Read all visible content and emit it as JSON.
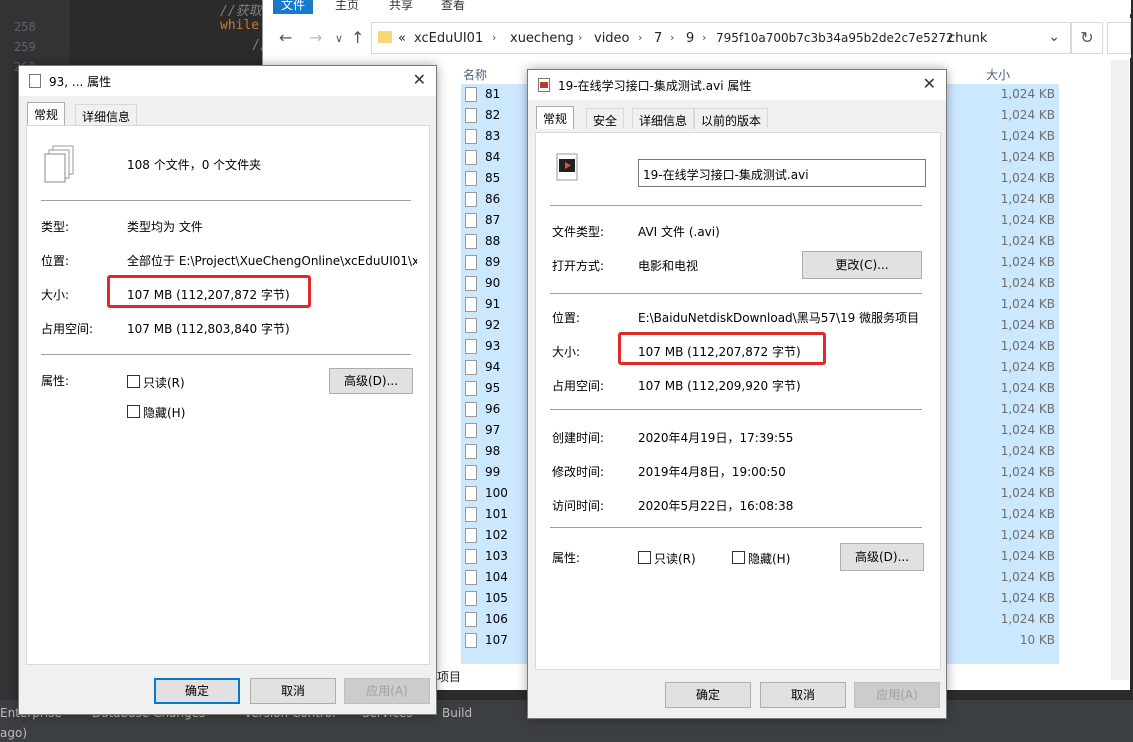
{
  "ide": {
    "line_numbers": [
      "258",
      "259",
      "260"
    ],
    "code_keyword": "while(",
    "code_comment_a": "//获取",
    "code_comment_b": "//",
    "bottom_items": [
      "Enterprise",
      "Database Changes",
      "Version Control",
      "Services",
      "Build"
    ],
    "bottom_left": "ago)"
  },
  "explorer": {
    "ribbon_tabs": [
      "文件",
      "主页",
      "共享",
      "查看"
    ],
    "breadcrumb_overflow": "«",
    "breadcrumbs": [
      "xcEduUI01",
      "xuecheng",
      "video",
      "7",
      "9",
      "795f10a700b7c3b34a95b2de2c7e5272",
      "chunk"
    ],
    "columns": {
      "name": "名称",
      "size": "大小"
    },
    "files": [
      {
        "name": "81",
        "size": "1,024 KB"
      },
      {
        "name": "82",
        "size": "1,024 KB"
      },
      {
        "name": "83",
        "size": "1,024 KB"
      },
      {
        "name": "84",
        "size": "1,024 KB"
      },
      {
        "name": "85",
        "size": "1,024 KB"
      },
      {
        "name": "86",
        "size": "1,024 KB"
      },
      {
        "name": "87",
        "size": "1,024 KB"
      },
      {
        "name": "88",
        "size": "1,024 KB"
      },
      {
        "name": "89",
        "size": "1,024 KB"
      },
      {
        "name": "90",
        "size": "1,024 KB"
      },
      {
        "name": "91",
        "size": "1,024 KB"
      },
      {
        "name": "92",
        "size": "1,024 KB"
      },
      {
        "name": "93",
        "size": "1,024 KB"
      },
      {
        "name": "94",
        "size": "1,024 KB"
      },
      {
        "name": "95",
        "size": "1,024 KB"
      },
      {
        "name": "96",
        "size": "1,024 KB"
      },
      {
        "name": "97",
        "size": "1,024 KB"
      },
      {
        "name": "98",
        "size": "1,024 KB"
      },
      {
        "name": "99",
        "size": "1,024 KB"
      },
      {
        "name": "100",
        "size": "1,024 KB"
      },
      {
        "name": "101",
        "size": "1,024 KB"
      },
      {
        "name": "102",
        "size": "1,024 KB"
      },
      {
        "name": "103",
        "size": "1,024 KB"
      },
      {
        "name": "104",
        "size": "1,024 KB"
      },
      {
        "name": "105",
        "size": "1,024 KB"
      },
      {
        "name": "106",
        "size": "1,024 KB"
      },
      {
        "name": "107",
        "size": "10 KB"
      }
    ],
    "status_text": "项目"
  },
  "dialog_a": {
    "title": "93, ... 属性",
    "tabs": [
      "常规",
      "详细信息"
    ],
    "summary": "108 个文件，0 个文件夹",
    "type_label": "类型:",
    "type_value": "类型均为 文件",
    "location_label": "位置:",
    "location_value": "全部位于 E:\\Project\\XueChengOnline\\xcEduUI01\\x",
    "size_label": "大小:",
    "size_value": "107 MB (112,207,872 字节)",
    "disk_label": "占用空间:",
    "disk_value": "107 MB (112,803,840 字节)",
    "attr_label": "属性:",
    "readonly": "只读(R)",
    "hidden": "隐藏(H)",
    "advanced": "高级(D)...",
    "ok": "确定",
    "cancel": "取消",
    "apply": "应用(A)"
  },
  "dialog_b": {
    "title": "19-在线学习接口-集成测试.avi 属性",
    "tabs": [
      "常规",
      "安全",
      "详细信息",
      "以前的版本"
    ],
    "filename": "19-在线学习接口-集成测试.avi",
    "filetype_label": "文件类型:",
    "filetype_value": "AVI 文件 (.avi)",
    "openwith_label": "打开方式:",
    "openwith_value": "电影和电视",
    "change": "更改(C)...",
    "location_label": "位置:",
    "location_value": "E:\\BaiduNetdiskDownload\\黑马57\\19 微服务项目【",
    "size_label": "大小:",
    "size_value": "107 MB (112,207,872 字节)",
    "disk_label": "占用空间:",
    "disk_value": "107 MB (112,209,920 字节)",
    "created_label": "创建时间:",
    "created_value": "2020年4月19日，17:39:55",
    "modified_label": "修改时间:",
    "modified_value": "2019年4月8日，19:00:50",
    "accessed_label": "访问时间:",
    "accessed_value": "2020年5月22日，16:08:38",
    "attr_label": "属性:",
    "readonly": "只读(R)",
    "hidden": "隐藏(H)",
    "advanced": "高级(D)...",
    "ok": "确定",
    "cancel": "取消",
    "apply": "应用(A)"
  },
  "colors": {
    "highlight": "#e02a2a",
    "selection": "#cce8ff",
    "accent": "#0078d7"
  }
}
